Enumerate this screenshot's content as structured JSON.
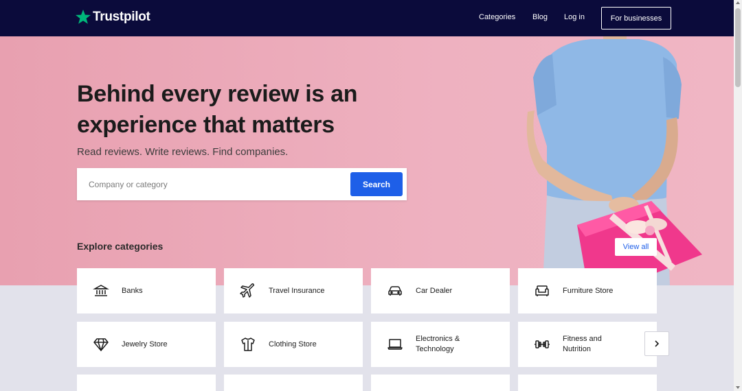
{
  "header": {
    "logo_text": "Trustpilot",
    "nav": [
      "Categories",
      "Blog",
      "Log in"
    ],
    "business_button": "For businesses"
  },
  "hero": {
    "title": "Behind every review is an experience that matters",
    "subtitle": "Read reviews. Write reviews. Find companies.",
    "search_placeholder": "Company or category",
    "search_button": "Search"
  },
  "explore": {
    "heading": "Explore categories",
    "view_all": "View all"
  },
  "categories": [
    {
      "label": "Banks",
      "icon": "bank-icon"
    },
    {
      "label": "Travel Insurance",
      "icon": "airplane-icon"
    },
    {
      "label": "Car Dealer",
      "icon": "car-icon"
    },
    {
      "label": "Furniture Store",
      "icon": "sofa-icon"
    },
    {
      "label": "Jewelry Store",
      "icon": "diamond-icon"
    },
    {
      "label": "Clothing Store",
      "icon": "shirt-icon"
    },
    {
      "label": "Electronics & Technology",
      "icon": "laptop-icon"
    },
    {
      "label": "Fitness and Nutrition",
      "icon": "dumbbell-icon"
    }
  ],
  "colors": {
    "header_bg": "#0b0b3b",
    "hero_bg": "#eeb1c0",
    "accent": "#1e5fe8",
    "logo_star": "#00b67a"
  }
}
